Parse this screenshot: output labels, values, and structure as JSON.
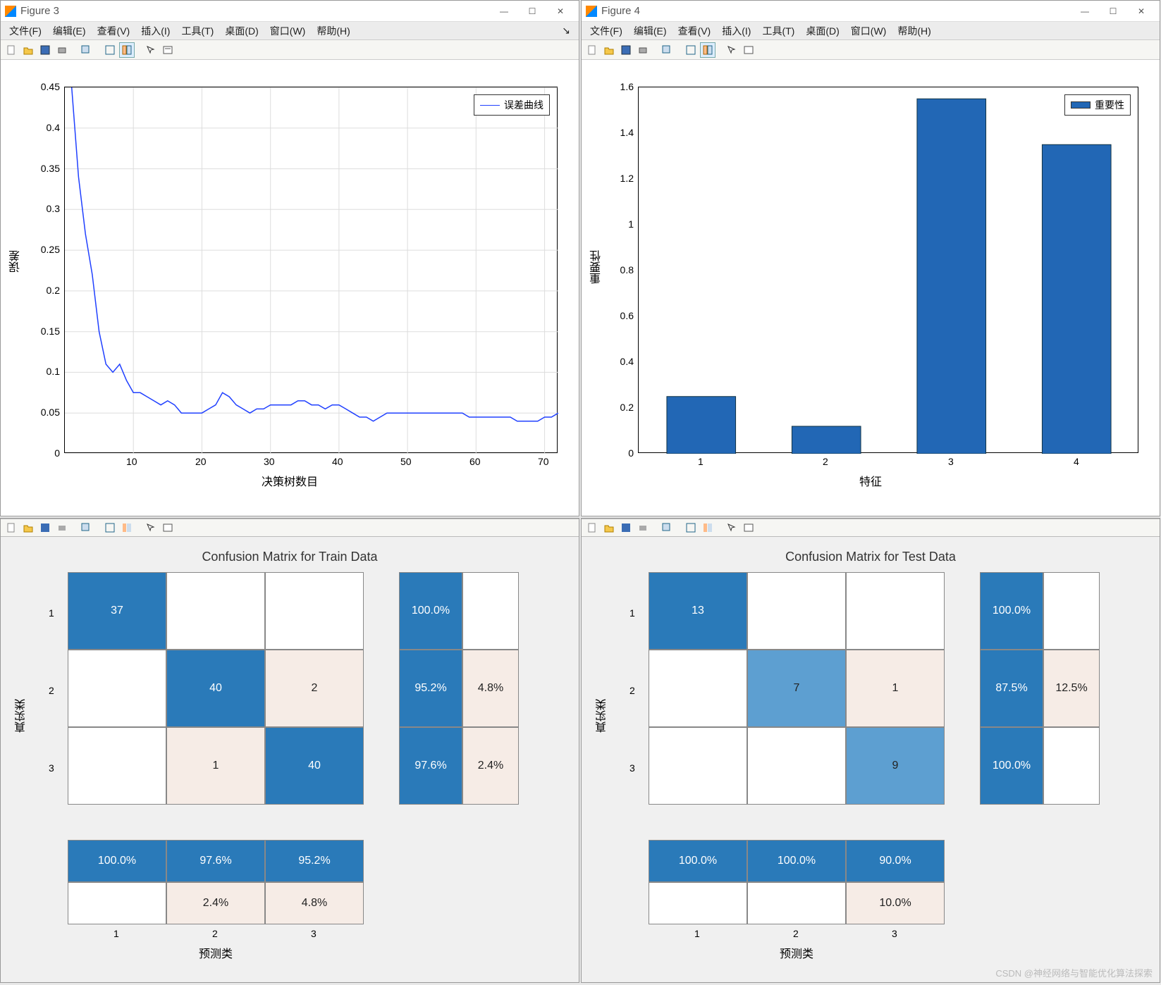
{
  "windows": {
    "fig3": {
      "title": "Figure 3"
    },
    "fig4": {
      "title": "Figure 4"
    }
  },
  "menubar": {
    "file": "文件(F)",
    "edit": "编辑(E)",
    "view": "查看(V)",
    "insert": "插入(I)",
    "tools": "工具(T)",
    "desktop": "桌面(D)",
    "window": "窗口(W)",
    "help": "帮助(H)"
  },
  "toolbar_icons": [
    "new",
    "open",
    "save",
    "print",
    "|",
    "copyfig",
    "|",
    "grid1",
    "grid2",
    "|",
    "arrow",
    "inspect"
  ],
  "chart_data": [
    {
      "id": "error_curve",
      "type": "line",
      "title": "",
      "xlabel": "决策树数目",
      "ylabel": "误差",
      "xlim": [
        0,
        72
      ],
      "ylim": [
        0,
        0.45
      ],
      "xticks": [
        10,
        20,
        30,
        40,
        50,
        60,
        70
      ],
      "yticks": [
        0,
        0.05,
        0.1,
        0.15,
        0.2,
        0.25,
        0.3,
        0.35,
        0.4,
        0.45
      ],
      "legend": "误差曲线",
      "series": [
        {
          "name": "误差曲线",
          "x": [
            1,
            2,
            3,
            4,
            5,
            6,
            7,
            8,
            9,
            10,
            11,
            12,
            13,
            14,
            15,
            16,
            17,
            18,
            19,
            20,
            21,
            22,
            23,
            24,
            25,
            26,
            27,
            28,
            29,
            30,
            31,
            32,
            33,
            34,
            35,
            36,
            37,
            38,
            39,
            40,
            41,
            42,
            43,
            44,
            45,
            46,
            47,
            48,
            49,
            50,
            51,
            52,
            53,
            54,
            55,
            56,
            57,
            58,
            59,
            60,
            61,
            62,
            63,
            64,
            65,
            66,
            67,
            68,
            69,
            70,
            71,
            72
          ],
          "y": [
            0.45,
            0.34,
            0.27,
            0.22,
            0.15,
            0.11,
            0.1,
            0.11,
            0.09,
            0.075,
            0.075,
            0.07,
            0.065,
            0.06,
            0.065,
            0.06,
            0.05,
            0.05,
            0.05,
            0.05,
            0.055,
            0.06,
            0.075,
            0.07,
            0.06,
            0.055,
            0.05,
            0.055,
            0.055,
            0.06,
            0.06,
            0.06,
            0.06,
            0.065,
            0.065,
            0.06,
            0.06,
            0.055,
            0.06,
            0.06,
            0.055,
            0.05,
            0.045,
            0.045,
            0.04,
            0.045,
            0.05,
            0.05,
            0.05,
            0.05,
            0.05,
            0.05,
            0.05,
            0.05,
            0.05,
            0.05,
            0.05,
            0.05,
            0.045,
            0.045,
            0.045,
            0.045,
            0.045,
            0.045,
            0.045,
            0.04,
            0.04,
            0.04,
            0.04,
            0.045,
            0.045,
            0.05
          ]
        }
      ]
    },
    {
      "id": "importance",
      "type": "bar",
      "title": "",
      "xlabel": "特征",
      "ylabel": "重要性",
      "xlim": [
        0.5,
        4.5
      ],
      "ylim": [
        0,
        1.6
      ],
      "yticks": [
        0,
        0.2,
        0.4,
        0.6,
        0.8,
        1.0,
        1.2,
        1.4,
        1.6
      ],
      "legend": "重要性",
      "categories": [
        1,
        2,
        3,
        4
      ],
      "values": [
        0.25,
        0.12,
        1.55,
        1.35
      ]
    },
    {
      "id": "confusion_train",
      "type": "heatmap",
      "title": "Confusion Matrix for Train Data",
      "xlabel": "预测类",
      "ylabel": "真实类",
      "row_labels": [
        1,
        2,
        3
      ],
      "col_labels": [
        1,
        2,
        3
      ],
      "matrix": [
        [
          37,
          0,
          0
        ],
        [
          0,
          40,
          2
        ],
        [
          0,
          1,
          40
        ]
      ],
      "row_percent": [
        [
          "100.0%",
          ""
        ],
        [
          "95.2%",
          "4.8%"
        ],
        [
          "97.6%",
          "2.4%"
        ]
      ],
      "col_percent": [
        [
          "100.0%",
          ""
        ],
        [
          "97.6%",
          "2.4%"
        ],
        [
          "95.2%",
          "4.8%"
        ]
      ]
    },
    {
      "id": "confusion_test",
      "type": "heatmap",
      "title": "Confusion Matrix for Test Data",
      "xlabel": "预测类",
      "ylabel": "真实类",
      "row_labels": [
        1,
        2,
        3
      ],
      "col_labels": [
        1,
        2,
        3
      ],
      "matrix": [
        [
          13,
          0,
          0
        ],
        [
          0,
          7,
          1
        ],
        [
          0,
          0,
          9
        ]
      ],
      "row_percent": [
        [
          "100.0%",
          ""
        ],
        [
          "87.5%",
          "12.5%"
        ],
        [
          "100.0%",
          ""
        ]
      ],
      "col_percent": [
        [
          "100.0%",
          ""
        ],
        [
          "100.0%",
          ""
        ],
        [
          "90.0%",
          "10.0%"
        ]
      ]
    }
  ],
  "watermark": "CSDN @神经网络与智能优化算法探索"
}
